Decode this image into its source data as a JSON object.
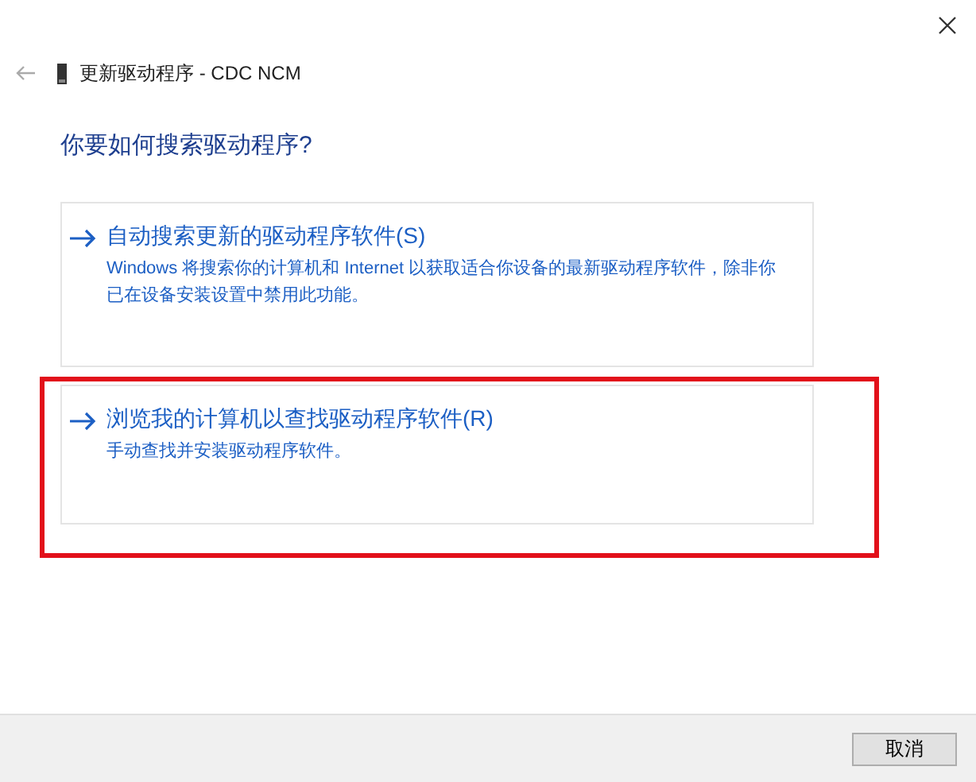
{
  "window": {
    "title": "更新驱动程序 - CDC NCM"
  },
  "heading": "你要如何搜索驱动程序?",
  "options": [
    {
      "title": "自动搜索更新的驱动程序软件(S)",
      "description": "Windows 将搜索你的计算机和 Internet 以获取适合你设备的最新驱动程序软件，除非你已在设备安装设置中禁用此功能。",
      "highlighted": false
    },
    {
      "title": "浏览我的计算机以查找驱动程序软件(R)",
      "description": "手动查找并安装驱动程序软件。",
      "highlighted": true
    }
  ],
  "buttons": [
    "取消"
  ]
}
